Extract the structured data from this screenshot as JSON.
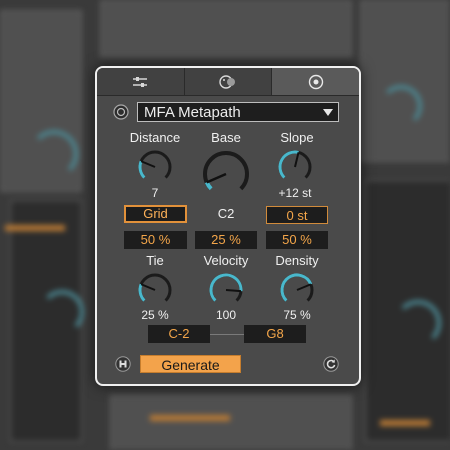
{
  "tabs": [
    {
      "icon": "sliders-icon"
    },
    {
      "icon": "dice-icon"
    },
    {
      "icon": "target-icon"
    }
  ],
  "preset": {
    "name": "MFA Metapath"
  },
  "knobs": {
    "distance": {
      "label": "Distance",
      "value": "7",
      "level": 0.25
    },
    "base": {
      "label": "Base",
      "value": "C2",
      "level": 0.08
    },
    "slope": {
      "label": "Slope",
      "value": "+12 st",
      "level": 0.55
    },
    "tie": {
      "label": "Tie",
      "value": "25 %",
      "level": 0.25
    },
    "velocity": {
      "label": "Velocity",
      "value": "100",
      "level": 0.85
    },
    "density": {
      "label": "Density",
      "value": "75 %",
      "level": 0.75
    }
  },
  "controls": {
    "grid_button": "Grid",
    "distance_pct": "50 %",
    "base_pct": "25 %",
    "slope_st": "0 st",
    "slope_pct": "50 %",
    "range_low": "C-2",
    "range_high": "G8",
    "generate_label": "Generate"
  },
  "colors": {
    "accent_blue": "#49b8cc",
    "accent_orange": "#f3a34b",
    "panel_bg": "#4a4a4a"
  }
}
